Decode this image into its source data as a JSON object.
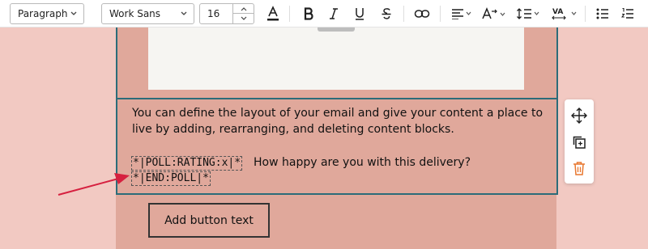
{
  "toolbar": {
    "block_style": "Paragraph",
    "font_family": "Work Sans",
    "font_size": "16",
    "icons": [
      "text-color-icon",
      "bold-icon",
      "italic-icon",
      "underline-icon",
      "strikethrough-icon",
      "link-icon",
      "align-left-icon",
      "text-size-icon",
      "line-height-icon",
      "letter-spacing-icon",
      "bullet-list-icon",
      "numbered-list-icon"
    ],
    "letter_spacing_label": "VA"
  },
  "content": {
    "paragraph": "You can define the layout of your email and give your content a place to live by adding, rearranging, and deleting content blocks.",
    "merge_tag_start": "*|POLL:RATING:x|*",
    "question": "How happy are you with this delivery?",
    "merge_tag_end": "*|END:POLL|*"
  },
  "button": {
    "label": "Add button text"
  },
  "side_tools": [
    "move-icon",
    "duplicate-icon",
    "delete-icon"
  ],
  "colors": {
    "page_background": "#f2c9c2",
    "column_background": "#e0a89b",
    "selection_border": "#2c6c79",
    "delete_icon": "#e8772e",
    "annotation_arrow": "#d6203f"
  }
}
